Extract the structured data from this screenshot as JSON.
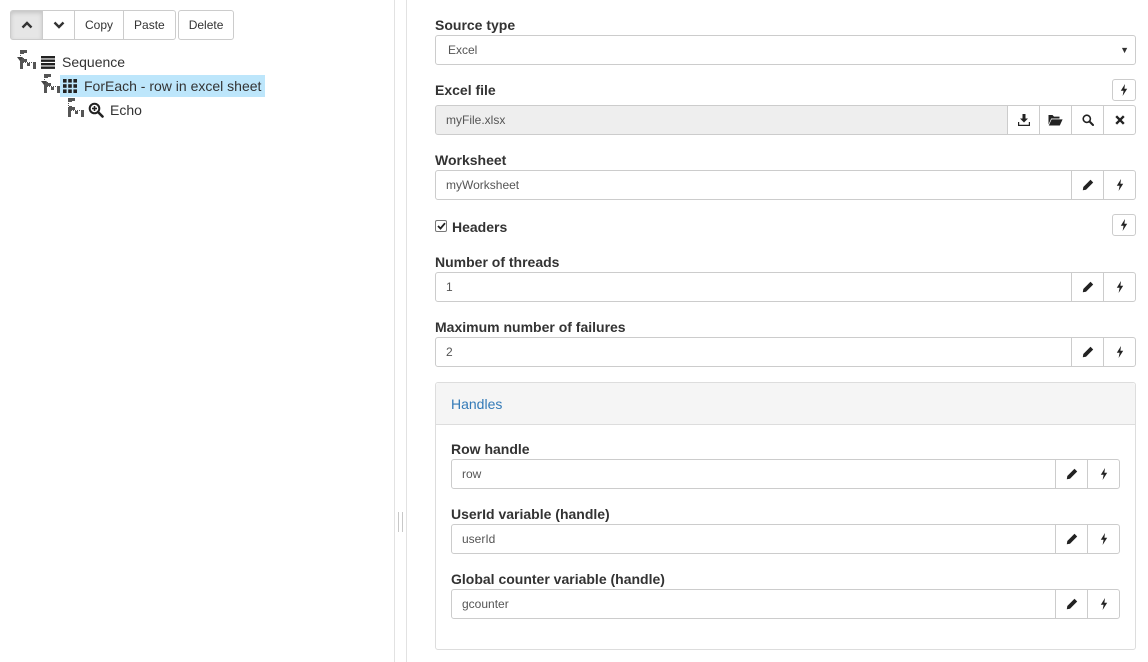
{
  "toolbar": {
    "move_up": "chevron-up-icon",
    "move_down": "chevron-down-icon",
    "copy_label": "Copy",
    "paste_label": "Paste",
    "delete_label": "Delete"
  },
  "tree": {
    "nodes": [
      {
        "label": "Sequence",
        "icon": "list-icon"
      },
      {
        "label": "ForEach - row in excel sheet",
        "icon": "grid-icon",
        "selected": true
      },
      {
        "label": "Echo",
        "icon": "zoom-in-icon"
      }
    ]
  },
  "form": {
    "source_type": {
      "label": "Source type",
      "value": "Excel"
    },
    "excel_file": {
      "label": "Excel file",
      "value": "myFile.xlsx",
      "buttons": [
        "download-icon",
        "folder-open-icon",
        "search-icon",
        "remove-icon"
      ]
    },
    "worksheet": {
      "label": "Worksheet",
      "value": "myWorksheet"
    },
    "headers": {
      "label": "Headers",
      "checked": true
    },
    "threads": {
      "label": "Number of threads",
      "value": "1"
    },
    "failures": {
      "label": "Maximum number of failures",
      "value": "2"
    },
    "handles": {
      "title": "Handles",
      "row": {
        "label": "Row handle",
        "value": "row"
      },
      "user_id": {
        "label": "UserId variable (handle)",
        "value": "userId"
      },
      "counter": {
        "label": "Global counter variable (handle)",
        "value": "gcounter"
      }
    }
  }
}
